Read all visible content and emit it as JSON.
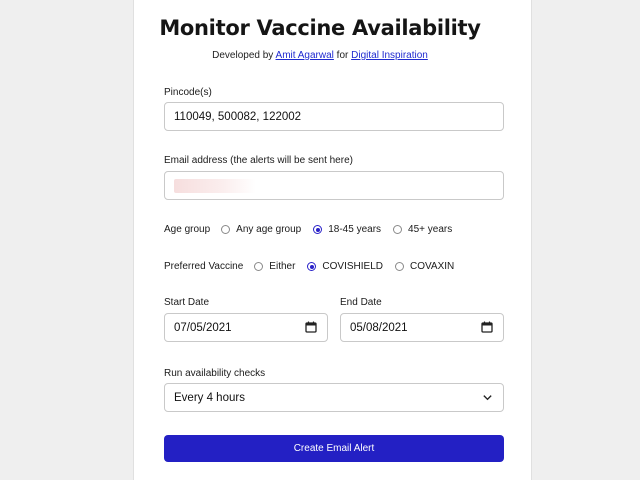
{
  "title": "Monitor Vaccine Availability",
  "subtitle": {
    "prefix": "Developed by",
    "author": "Amit Agarwal",
    "middle": "for",
    "site": "Digital Inspiration"
  },
  "pincode": {
    "label": "Pincode(s)",
    "value": "110049, 500082, 122002"
  },
  "email": {
    "label": "Email address (the alerts will be sent here)",
    "value": ""
  },
  "age_group": {
    "label": "Age group",
    "options": [
      "Any age group",
      "18-45 years",
      "45+ years"
    ],
    "selected": "18-45 years"
  },
  "vaccine": {
    "label": "Preferred Vaccine",
    "options": [
      "Either",
      "COVISHIELD",
      "COVAXIN"
    ],
    "selected": "COVISHIELD"
  },
  "start_date": {
    "label": "Start Date",
    "value": "07/05/2021"
  },
  "end_date": {
    "label": "End Date",
    "value": "05/08/2021"
  },
  "frequency": {
    "label": "Run availability checks",
    "value": "Every 4 hours"
  },
  "submit_label": "Create Email Alert",
  "colors": {
    "accent": "#2320c4",
    "link": "#1f2ad0"
  }
}
